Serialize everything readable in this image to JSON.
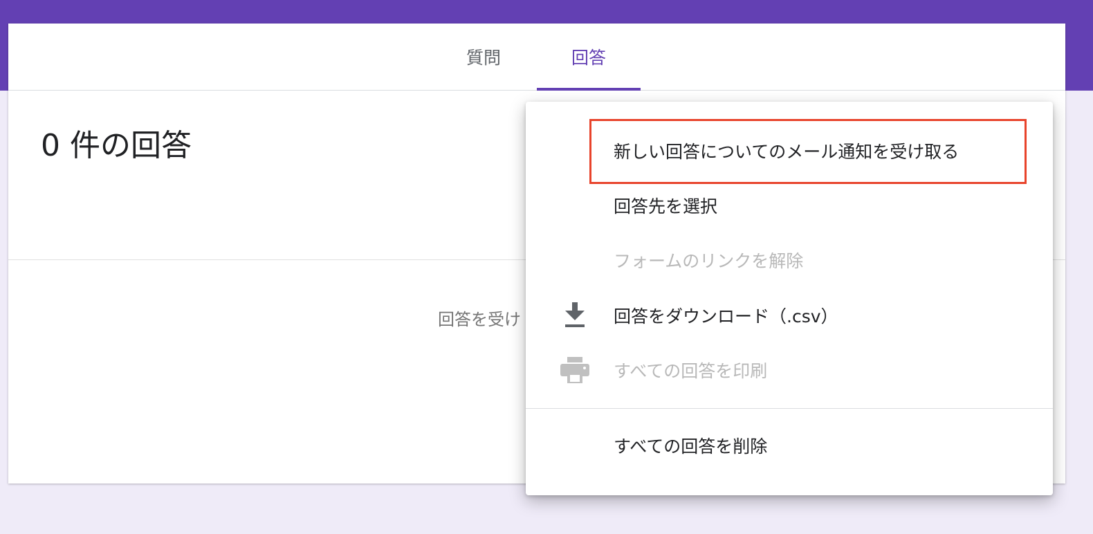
{
  "colors": {
    "brand": "#6340b3",
    "page_background": "#efebf8",
    "highlight": "#e8432b",
    "disabled_text": "#b8b8b8"
  },
  "tabs": [
    {
      "label": "質問",
      "active": false
    },
    {
      "label": "回答",
      "active": true
    }
  ],
  "responses": {
    "summary_title": "0 件の回答",
    "status_text": "回答を受け"
  },
  "menu": {
    "items": [
      {
        "label": "新しい回答についてのメール通知を受け取る",
        "icon": null,
        "enabled": true,
        "highlighted": true
      },
      {
        "label": "回答先を選択",
        "icon": null,
        "enabled": true
      },
      {
        "label": "フォームのリンクを解除",
        "icon": null,
        "enabled": false
      },
      {
        "label": "回答をダウンロード（.csv）",
        "icon": "download-icon",
        "enabled": true
      },
      {
        "label": "すべての回答を印刷",
        "icon": "print-icon",
        "enabled": false
      },
      {
        "label": "すべての回答を削除",
        "icon": null,
        "enabled": true
      }
    ]
  }
}
